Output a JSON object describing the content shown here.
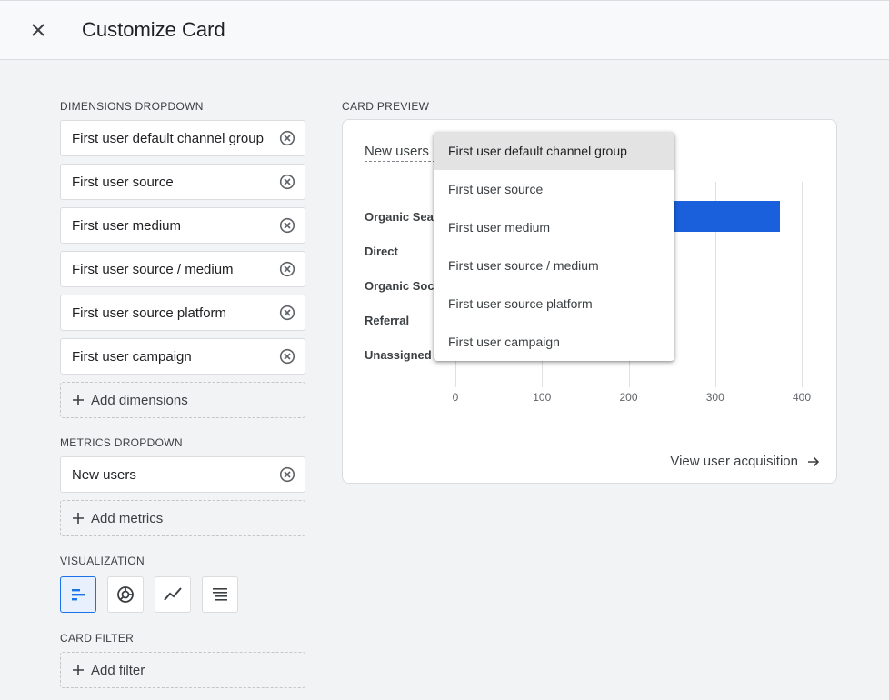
{
  "header": {
    "title": "Customize Card"
  },
  "dimensions": {
    "label": "DIMENSIONS DROPDOWN",
    "items": [
      "First user default channel group",
      "First user source",
      "First user medium",
      "First user source / medium",
      "First user source platform",
      "First user campaign"
    ],
    "add_label": "Add dimensions"
  },
  "metrics": {
    "label": "METRICS DROPDOWN",
    "items": [
      "New users"
    ],
    "add_label": "Add metrics"
  },
  "visualization": {
    "label": "VISUALIZATION",
    "options": [
      "bar-chart-icon",
      "donut-chart-icon",
      "line-chart-icon",
      "table-icon"
    ],
    "selected": 0
  },
  "card_filter": {
    "label": "CARD FILTER",
    "add_label": "Add filter"
  },
  "preview": {
    "label": "CARD PREVIEW",
    "title": "New users b",
    "link": "View user acquisition"
  },
  "chart_data": {
    "type": "bar",
    "orientation": "horizontal",
    "categories": [
      "Organic Sear",
      "Direct",
      "Organic Socia",
      "Referral",
      "Unassigned"
    ],
    "series": [
      {
        "values": [
          375,
          null,
          null,
          null,
          null
        ]
      }
    ],
    "xlim": [
      0,
      400
    ],
    "xticks": [
      0,
      100,
      200,
      300,
      400
    ],
    "tick_labels": [
      "0",
      "100",
      "200",
      "300",
      "400"
    ],
    "grid": true,
    "bar_color": "#1a5fdc"
  },
  "dropdown": {
    "items": [
      "First user default channel group",
      "First user source",
      "First user medium",
      "First user source / medium",
      "First user source platform",
      "First user campaign"
    ],
    "highlighted": 0
  }
}
